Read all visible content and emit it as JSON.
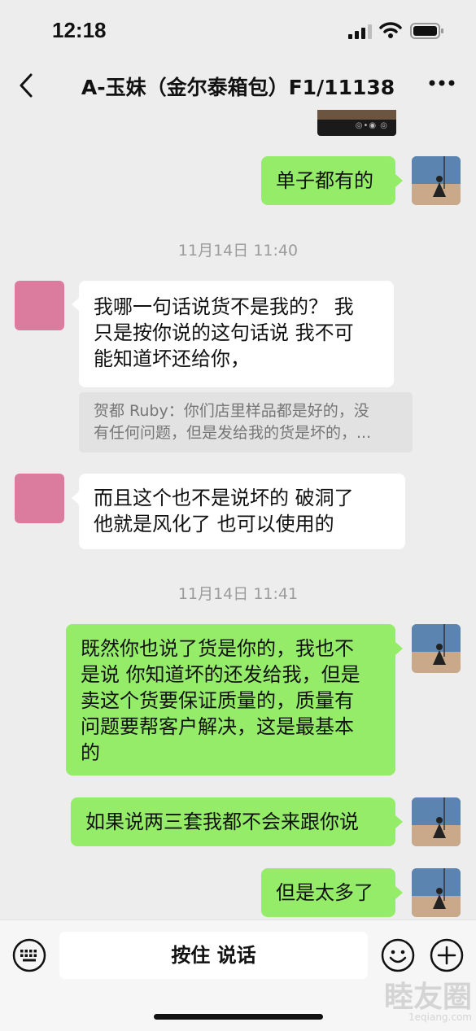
{
  "status_bar": {
    "time": "12:18"
  },
  "nav": {
    "title": "A-玉妹（金尔泰箱包）F1/11138"
  },
  "messages": [
    {
      "text": "单子都有的"
    },
    {
      "text": "我哪一句话说货不是我的？  我\n只是按你说的这句话说  我不可\n能知道坏还给你，"
    },
    {
      "text": "而且这个也不是说坏的  破洞了\n他就是风化了   也可以使用的"
    },
    {
      "text": "既然你也说了货是你的，我也不\n是说 你知道坏的还发给我，但是\n卖这个货要保证质量的，质量有\n问题要帮客户解决，这是最基本\n的"
    },
    {
      "text": "如果说两三套我都不会来跟你说"
    },
    {
      "text": "但是太多了"
    }
  ],
  "timestamps": [
    "11月14日 11:40",
    "11月14日 11:41"
  ],
  "quote": {
    "line1": "贺都 Ruby：你们店里样品都是好的，没",
    "line2": "有任何问题，但是发给我的货是坏的，..."
  },
  "input": {
    "hold_to_talk": "按住 说话"
  },
  "watermark": {
    "main": "睦友圈",
    "sub": "1eqiang.com"
  },
  "colors": {
    "background": "#ededed",
    "sent_bubble": "#95ec69",
    "received_bubble": "#ffffff",
    "contact_avatar": "#db7b9e"
  }
}
